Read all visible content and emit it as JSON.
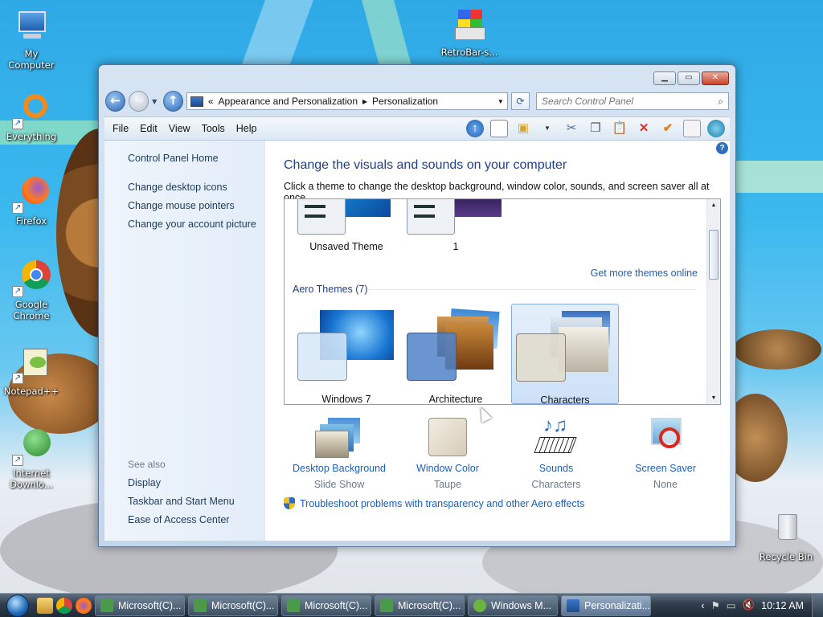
{
  "desktop": {
    "icons": [
      {
        "label": "My Computer"
      },
      {
        "label": "RetroBar-s..."
      },
      {
        "label": "Everything"
      },
      {
        "label": "Firefox"
      },
      {
        "label": "Google Chrome"
      },
      {
        "label": "Notepad++"
      },
      {
        "label": "Internet Downlo..."
      },
      {
        "label": "Recycle Bin"
      }
    ]
  },
  "window": {
    "address": {
      "prefix": "«",
      "crumb1": "Appearance and Personalization",
      "sep": "▸",
      "crumb2": "Personalization"
    },
    "search": {
      "placeholder": "Search Control Panel"
    },
    "menu": [
      "File",
      "Edit",
      "View",
      "Tools",
      "Help"
    ],
    "left_pane": {
      "home": "Control Panel Home",
      "links": [
        "Change desktop icons",
        "Change mouse pointers",
        "Change your account picture"
      ],
      "see_also_title": "See also",
      "see_also": [
        "Display",
        "Taskbar and Start Menu",
        "Ease of Access Center"
      ]
    },
    "main": {
      "heading": "Change the visuals and sounds on your computer",
      "subtext": "Click a theme to change the desktop background, window color, sounds, and screen saver all at once.",
      "my_themes": [
        {
          "label": "Unsaved Theme"
        },
        {
          "label": "1"
        }
      ],
      "get_more": "Get more themes online",
      "aero_group": "Aero Themes (7)",
      "aero_themes": [
        {
          "label": "Windows 7",
          "selected": false
        },
        {
          "label": "Architecture",
          "selected": false
        },
        {
          "label": "Characters",
          "selected": true
        }
      ],
      "bottom": [
        {
          "link": "Desktop Background",
          "sub": "Slide Show"
        },
        {
          "link": "Window Color",
          "sub": "Taupe"
        },
        {
          "link": "Sounds",
          "sub": "Characters"
        },
        {
          "link": "Screen Saver",
          "sub": "None"
        }
      ],
      "troubleshoot": "Troubleshoot problems with transparency and other Aero effects"
    }
  },
  "taskbar": {
    "tasks": [
      {
        "label": "Microsoft(C)...",
        "active": false
      },
      {
        "label": "Microsoft(C)...",
        "active": false
      },
      {
        "label": "Microsoft(C)...",
        "active": false
      },
      {
        "label": "Microsoft(C)...",
        "active": false
      },
      {
        "label": "Windows M...",
        "active": false
      },
      {
        "label": "Personalizati...",
        "active": true
      }
    ],
    "clock": "10:12 AM"
  },
  "colors": {
    "link": "#1e5fb4",
    "heading": "#1e3f8a",
    "taupe": "#e5dccb"
  }
}
